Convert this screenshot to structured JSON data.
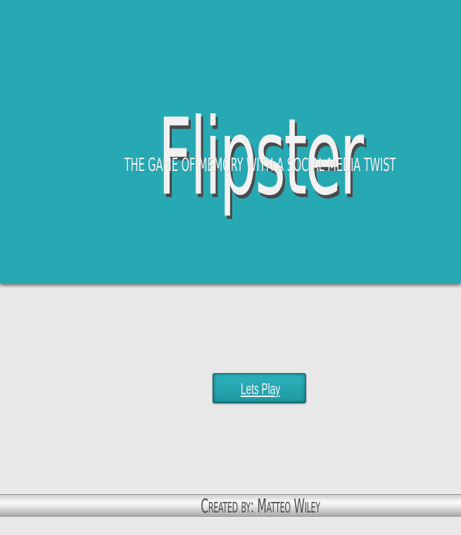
{
  "hero": {
    "title": "Flipster",
    "subtitle": "The game of memory with a social media twist"
  },
  "main": {
    "play_label": "Lets Play"
  },
  "footer": {
    "credit": "Created by: Matteo Wiley"
  },
  "colors": {
    "hero_background": "#27a9b4",
    "page_background": "#e8e8e8",
    "title_shadow": "#4a4a4a",
    "button_border": "#165c62"
  }
}
